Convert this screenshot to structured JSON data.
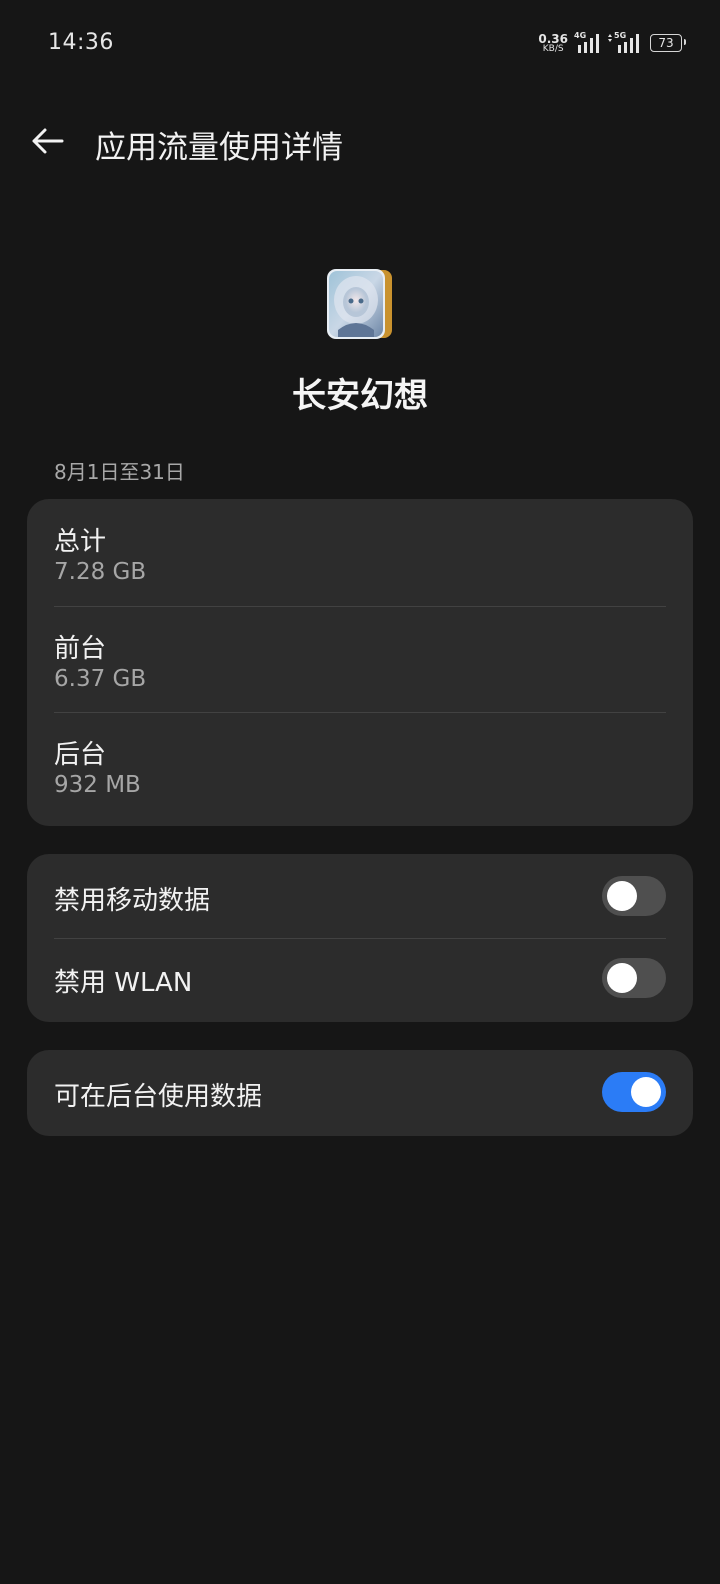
{
  "status_bar": {
    "time": "14:36",
    "net_speed_value": "0.36",
    "net_speed_unit": "KB/S",
    "signal_1_label": "4G",
    "signal_2_label": "5G",
    "battery": "73"
  },
  "header": {
    "title": "应用流量使用详情",
    "back_icon": "arrow-left-icon"
  },
  "app": {
    "name": "长安幻想",
    "icon": "app-icon"
  },
  "date_range": "8月1日至31日",
  "usage": [
    {
      "label": "总计",
      "value": "7.28 GB"
    },
    {
      "label": "前台",
      "value": "6.37 GB"
    },
    {
      "label": "后台",
      "value": "932 MB"
    }
  ],
  "restrictions": [
    {
      "label": "禁用移动数据",
      "enabled": false
    },
    {
      "label": "禁用 WLAN",
      "enabled": false
    }
  ],
  "background_data": {
    "label": "可在后台使用数据",
    "enabled": true
  },
  "colors": {
    "background": "#161616",
    "card": "#2c2c2c",
    "accent": "#2b7cf6",
    "switch_off": "#4f4f4f",
    "secondary_text": "#a6a6a6"
  }
}
